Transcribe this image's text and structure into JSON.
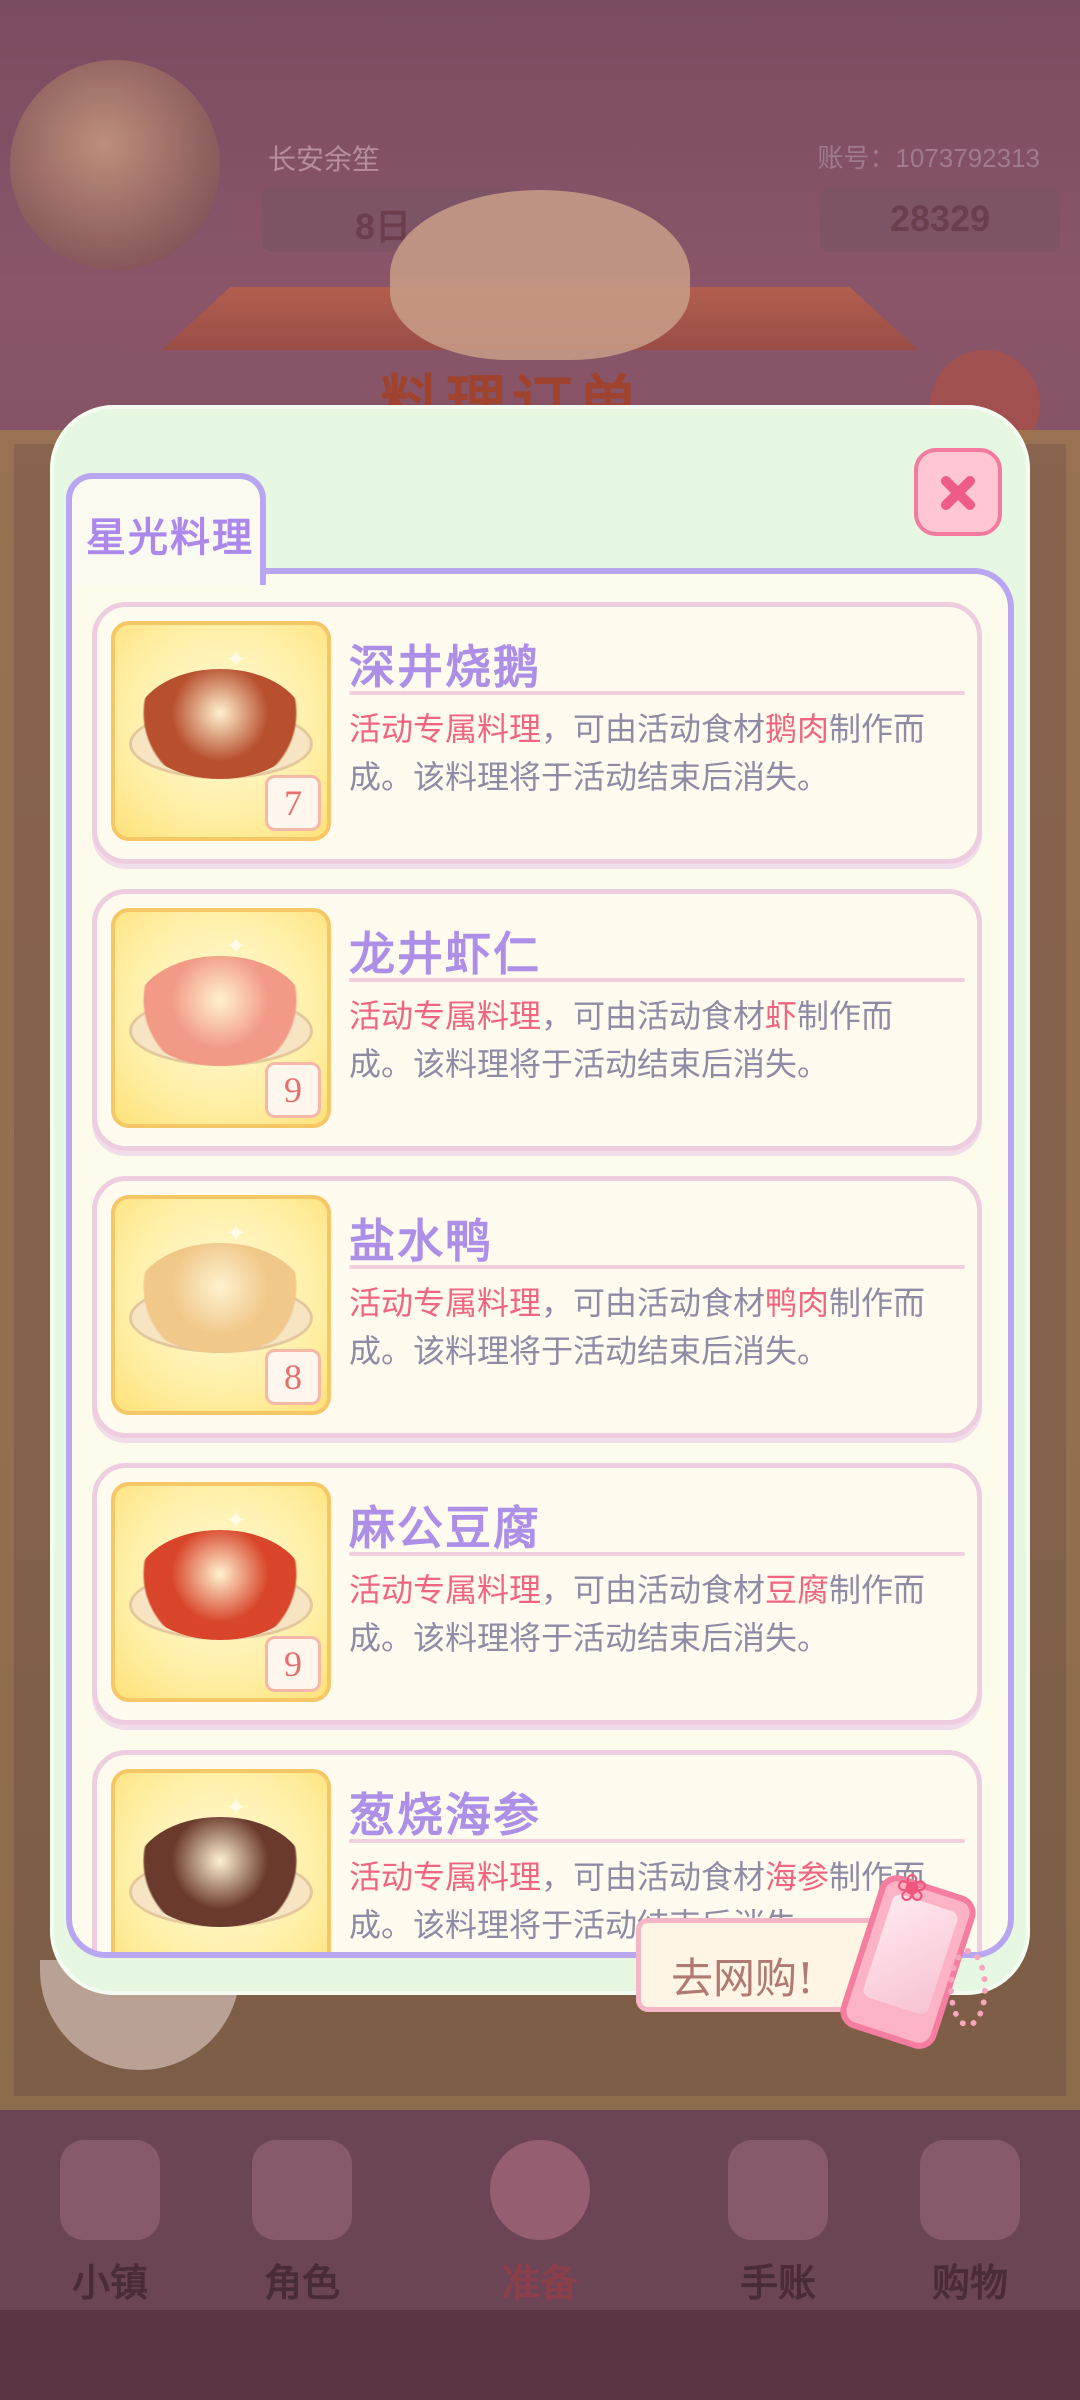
{
  "background": {
    "player_name": "长安余笙",
    "account_label": "账号：1073792313",
    "day_label": "8日",
    "currency_value": "28329",
    "window_title": "料理订单",
    "nav": [
      {
        "label": "小镇",
        "icon": "map-icon"
      },
      {
        "label": "角色",
        "icon": "character-icon"
      },
      {
        "label": "准备",
        "icon": "prepare-icon"
      },
      {
        "label": "手账",
        "icon": "journal-icon"
      },
      {
        "label": "购物",
        "icon": "shopping-bag-icon"
      }
    ]
  },
  "modal": {
    "tab_label": "星光料理",
    "close_icon": "close-icon",
    "shop_button_label": "去网购!",
    "items": [
      {
        "name": "深井烧鹅",
        "count": "7",
        "tag": "活动专属料理",
        "text_before": "，可由活动食材",
        "ingredient": "鹅肉",
        "text_after": "制作而成。该料理将于活动结束后消失。",
        "dish_color": "#b8502e"
      },
      {
        "name": "龙井虾仁",
        "count": "9",
        "tag": "活动专属料理",
        "text_before": "，可由活动食材",
        "ingredient": "虾",
        "text_after": "制作而成。该料理将于活动结束后消失。",
        "dish_color": "#f29a86"
      },
      {
        "name": "盐水鸭",
        "count": "8",
        "tag": "活动专属料理",
        "text_before": "，可由活动食材",
        "ingredient": "鸭肉",
        "text_after": "制作而成。该料理将于活动结束后消失。",
        "dish_color": "#f0c88a"
      },
      {
        "name": "麻公豆腐",
        "count": "9",
        "tag": "活动专属料理",
        "text_before": "，可由活动食材",
        "ingredient": "豆腐",
        "text_after": "制作而成。该料理将于活动结束后消失。",
        "dish_color": "#d8452a"
      },
      {
        "name": "葱烧海参",
        "count": "",
        "tag": "活动专属料理",
        "text_before": "，可由活动食材",
        "ingredient": "海参",
        "text_after": "制作而成。该料理将于活动结束后消失。",
        "dish_color": "#6a3a2c"
      }
    ]
  }
}
